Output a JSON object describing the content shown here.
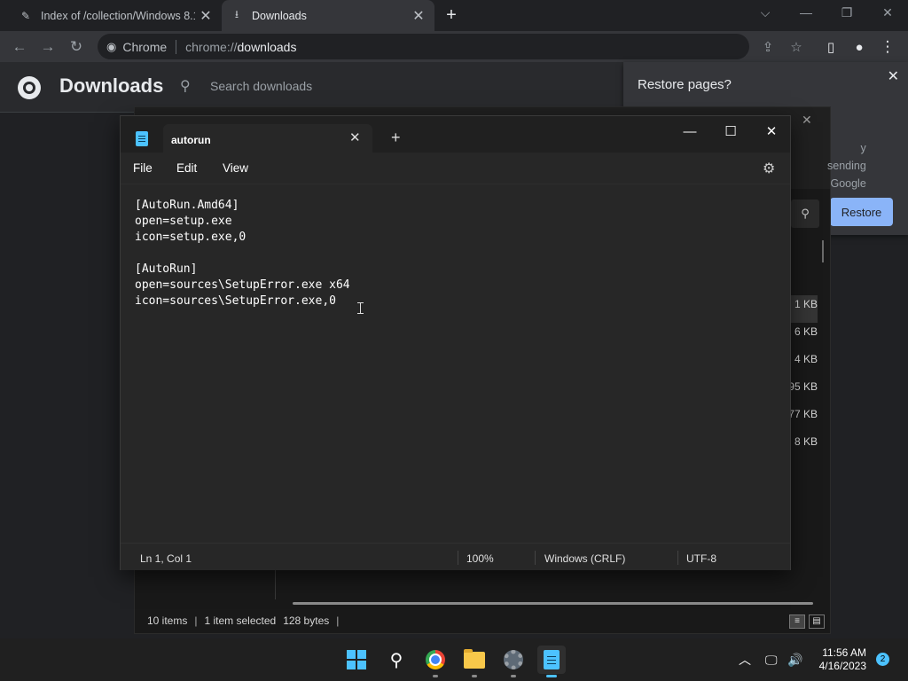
{
  "browser": {
    "tabs": [
      {
        "title": "Index of /collection/Windows 8.1",
        "favicon": "globe-icon"
      },
      {
        "title": "Downloads",
        "favicon": "download-icon"
      }
    ],
    "new_tab": "+",
    "window_controls": {
      "tab_search": "⌵",
      "minimize": "—",
      "restore": "❐",
      "close": "✕"
    },
    "omnibox": {
      "chip": "Chrome",
      "url_scheme": "chrome://",
      "url_host": "downloads"
    }
  },
  "downloads_page": {
    "title": "Downloads",
    "search_placeholder": "Search downloads"
  },
  "restore_bubble": {
    "title": "Restore pages?",
    "body_line1": "y sending",
    "body_line2": "Google",
    "restore_label": "Restore",
    "close": "✕"
  },
  "explorer": {
    "sizes": [
      "1 KB",
      "6 KB",
      "4 KB",
      "95 KB",
      "77 KB",
      "8 KB"
    ],
    "selected_index": 0,
    "status": {
      "items": "10 items",
      "selected": "1 item selected",
      "size": "128 bytes"
    }
  },
  "notepad": {
    "tab_title": "autorun",
    "menu": {
      "file": "File",
      "edit": "Edit",
      "view": "View"
    },
    "content": "[AutoRun.Amd64]\nopen=setup.exe\nicon=setup.exe,0\n\n[AutoRun]\nopen=sources\\SetupError.exe x64\nicon=sources\\SetupError.exe,0",
    "status": {
      "position": "Ln 1, Col 1",
      "zoom": "100%",
      "line_ending": "Windows (CRLF)",
      "encoding": "UTF-8"
    },
    "controls": {
      "minimize": "—",
      "maximize": "☐",
      "close": "✕"
    }
  },
  "taskbar": {
    "apps": [
      "start-icon",
      "search-icon",
      "chrome-icon",
      "file-explorer-icon",
      "settings-icon",
      "notepad-icon"
    ],
    "clock": {
      "time": "11:56 AM",
      "date": "4/16/2023"
    },
    "notifications": "2"
  }
}
